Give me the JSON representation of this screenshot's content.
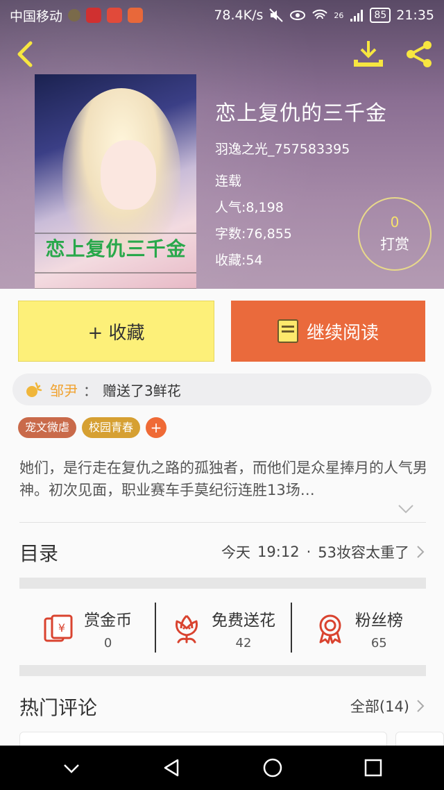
{
  "status_bar": {
    "carrier": "中国移动",
    "speed": "78.4K/s",
    "network": "26",
    "battery": "85",
    "time": "21:35"
  },
  "book": {
    "title": "恋上复仇的三千金",
    "cover_title": "恋上复仇三千金",
    "author": "羽逸之光_757583395",
    "status": "连载",
    "popularity": "人气:8,198",
    "word_count": "字数:76,855",
    "favorites": "收藏:54"
  },
  "tip": {
    "count": "0",
    "label": "打赏"
  },
  "actions": {
    "favorite": "+ 收藏",
    "continue": "继续阅读"
  },
  "gift_notice": {
    "user": "邹尹",
    "sep": "：",
    "text": "赠送了3鲜花"
  },
  "tags": [
    "宠文微虐",
    "校园青春"
  ],
  "tag_add": "+",
  "intro": "她们，是行走在复仇之路的孤独者，而他们是众星捧月的人气男神。初次见面，职业赛车手莫纪衍连胜13场…",
  "toc": {
    "title": "目录",
    "date": "今天",
    "time": "19:12",
    "dot": "·",
    "latest": "53妆容太重了"
  },
  "stats": [
    {
      "label": "赏金币",
      "value": "0",
      "icon": "red-envelope-icon"
    },
    {
      "label": "免费送花",
      "value": "42",
      "icon": "flower-icon"
    },
    {
      "label": "粉丝榜",
      "value": "65",
      "icon": "medal-icon"
    }
  ],
  "comments": {
    "title": "热门评论",
    "all": "全部(14)"
  },
  "colors": {
    "accent_orange": "#ea6a3c",
    "accent_yellow": "#fdf079",
    "icon_red": "#d9432f"
  }
}
